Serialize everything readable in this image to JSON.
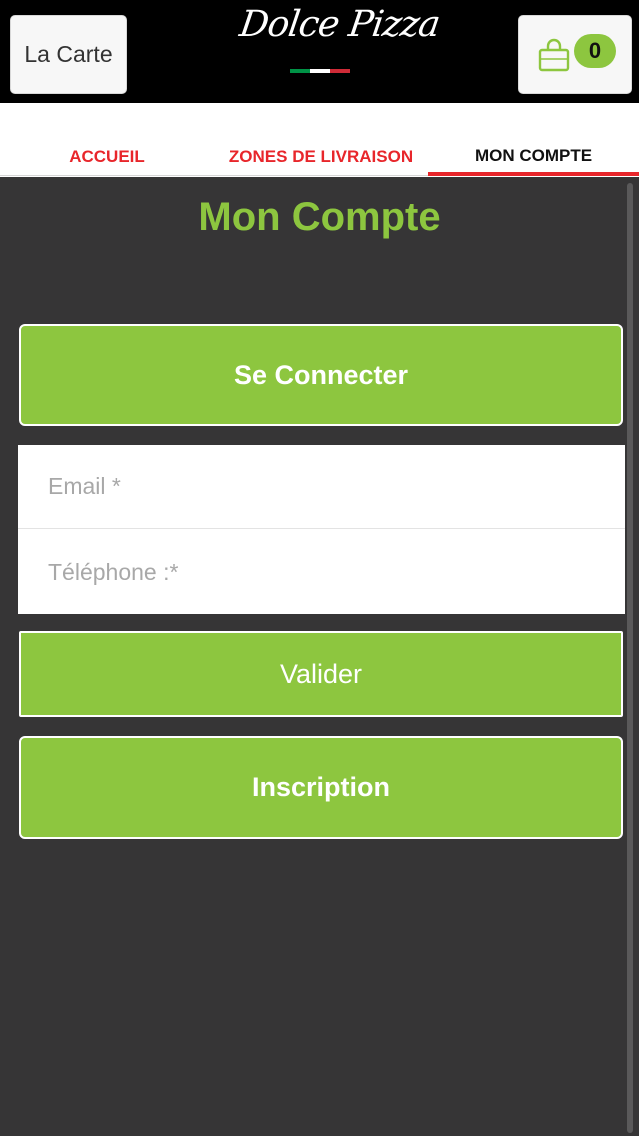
{
  "header": {
    "menu_label": "La Carte",
    "logo_text": "Dolce Pizza",
    "cart_count": "0",
    "cart_icon": "shopping-bag-icon"
  },
  "tabs": [
    {
      "label": "ACCUEIL",
      "active": false
    },
    {
      "label": "ZONES DE LIVRAISON",
      "active": false
    },
    {
      "label": "MON COMPTE",
      "active": true
    }
  ],
  "page": {
    "title": "Mon Compte",
    "connect_label": "Se Connecter",
    "email_placeholder": "Email *",
    "phone_placeholder": "Téléphone :*",
    "validate_label": "Valider",
    "signup_label": "Inscription"
  },
  "colors": {
    "accent_green": "#8dc63f",
    "tab_red": "#e8262b",
    "background_dark": "#363536",
    "topbar": "#000000",
    "flag": [
      "#009246",
      "#ffffff",
      "#ce2b37"
    ]
  }
}
